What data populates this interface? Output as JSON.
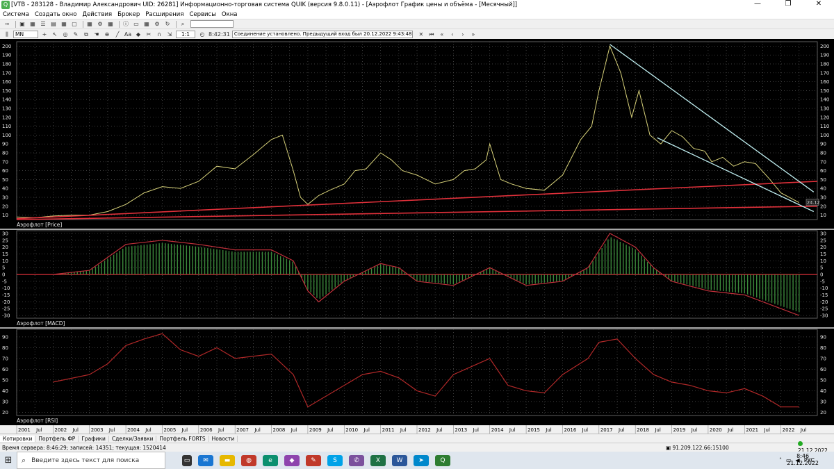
{
  "window": {
    "title": "[VTB - 283128 - Владимир Александрович UID: 26281] Информационно-торговая система QUIK (версия 9.8.0.11) - [Аэрофлот График цены и объёма - [Месячный]]",
    "minimize": "—",
    "restore": "❐",
    "close": "✕"
  },
  "menu": [
    "Система",
    "Создать окно",
    "Действия",
    "Брокер",
    "Расширения",
    "Сервисы",
    "Окна"
  ],
  "toolbar": {
    "interval": "MN",
    "zoom": "1:1",
    "time": "8:42:31",
    "status_message": "Соединение установлено. Предыдущий вход был 20.12.2022 9:43:48 с"
  },
  "chart": {
    "price_label": "Аэрофлот [Price]",
    "macd_label": "Аэрофлот [MACD]",
    "rsi_label": "Аэрофлот [RSI]",
    "last_price": "24.12",
    "colors": {
      "price": "#d8d27a",
      "trend": "#e0303a",
      "channel": "#bfeef0",
      "macd_line": "#c0303a",
      "histogram": "#3c8a3c",
      "rsi": "#b02828",
      "grid": "#555555",
      "axis_text": "#e8e8e8"
    },
    "years": [
      "2001",
      "2002",
      "2003",
      "2004",
      "2005",
      "2006",
      "2007",
      "2008",
      "2009",
      "2010",
      "2011",
      "2012",
      "2013",
      "2014",
      "2015",
      "2016",
      "2017",
      "2018",
      "2019",
      "2020",
      "2021",
      "2022"
    ],
    "month_label": "Jul"
  },
  "chart_data": [
    {
      "type": "line",
      "name": "price",
      "x": [
        "2001",
        "2002",
        "2003",
        "2004",
        "2005",
        "2006",
        "2007",
        "2008",
        "2009",
        "2010",
        "2011",
        "2012",
        "2013",
        "2014",
        "2015",
        "2016",
        "2017",
        "2018",
        "2019",
        "2020",
        "2021",
        "2022"
      ],
      "points": [
        [
          2001.0,
          8
        ],
        [
          2001.5,
          7
        ],
        [
          2002.0,
          9
        ],
        [
          2002.5,
          10
        ],
        [
          2003.0,
          10
        ],
        [
          2003.5,
          14
        ],
        [
          2004.0,
          22
        ],
        [
          2004.5,
          35
        ],
        [
          2005.0,
          42
        ],
        [
          2005.5,
          40
        ],
        [
          2006.0,
          48
        ],
        [
          2006.5,
          65
        ],
        [
          2007.0,
          62
        ],
        [
          2007.5,
          78
        ],
        [
          2008.0,
          95
        ],
        [
          2008.3,
          100
        ],
        [
          2008.6,
          60
        ],
        [
          2008.8,
          30
        ],
        [
          2009.0,
          22
        ],
        [
          2009.3,
          32
        ],
        [
          2009.6,
          38
        ],
        [
          2010.0,
          45
        ],
        [
          2010.3,
          60
        ],
        [
          2010.6,
          62
        ],
        [
          2011.0,
          80
        ],
        [
          2011.3,
          72
        ],
        [
          2011.6,
          60
        ],
        [
          2012.0,
          55
        ],
        [
          2012.5,
          45
        ],
        [
          2013.0,
          50
        ],
        [
          2013.3,
          60
        ],
        [
          2013.6,
          62
        ],
        [
          2013.9,
          72
        ],
        [
          2014.0,
          90
        ],
        [
          2014.3,
          50
        ],
        [
          2014.6,
          45
        ],
        [
          2015.0,
          40
        ],
        [
          2015.5,
          38
        ],
        [
          2016.0,
          55
        ],
        [
          2016.5,
          95
        ],
        [
          2016.8,
          110
        ],
        [
          2017.0,
          150
        ],
        [
          2017.3,
          200
        ],
        [
          2017.6,
          170
        ],
        [
          2017.9,
          120
        ],
        [
          2018.1,
          150
        ],
        [
          2018.4,
          100
        ],
        [
          2018.7,
          90
        ],
        [
          2019.0,
          105
        ],
        [
          2019.3,
          98
        ],
        [
          2019.6,
          85
        ],
        [
          2019.9,
          82
        ],
        [
          2020.1,
          70
        ],
        [
          2020.4,
          75
        ],
        [
          2020.7,
          65
        ],
        [
          2021.0,
          70
        ],
        [
          2021.3,
          68
        ],
        [
          2021.7,
          50
        ],
        [
          2022.0,
          35
        ],
        [
          2022.5,
          24.12
        ]
      ],
      "ylim": [
        5,
        205
      ]
    },
    {
      "type": "bar",
      "name": "MACD",
      "ylim": [
        -30,
        32
      ],
      "points": [
        [
          2002.0,
          0
        ],
        [
          2003.0,
          3
        ],
        [
          2004.0,
          22
        ],
        [
          2005.0,
          25
        ],
        [
          2006.0,
          22
        ],
        [
          2007.0,
          18
        ],
        [
          2008.0,
          18
        ],
        [
          2008.6,
          10
        ],
        [
          2009.0,
          -12
        ],
        [
          2009.3,
          -20
        ],
        [
          2010.0,
          -5
        ],
        [
          2011.0,
          8
        ],
        [
          2011.5,
          5
        ],
        [
          2012.0,
          -5
        ],
        [
          2013.0,
          -8
        ],
        [
          2014.0,
          5
        ],
        [
          2015.0,
          -8
        ],
        [
          2016.0,
          -5
        ],
        [
          2016.7,
          5
        ],
        [
          2017.3,
          30
        ],
        [
          2018.0,
          20
        ],
        [
          2018.5,
          5
        ],
        [
          2019.0,
          -5
        ],
        [
          2020.0,
          -12
        ],
        [
          2021.0,
          -15
        ],
        [
          2022.0,
          -25
        ],
        [
          2022.5,
          -30
        ]
      ]
    },
    {
      "type": "line",
      "name": "RSI",
      "ylim": [
        20,
        95
      ],
      "points": [
        [
          2002.0,
          48
        ],
        [
          2003.0,
          55
        ],
        [
          2003.5,
          65
        ],
        [
          2004.0,
          82
        ],
        [
          2004.5,
          88
        ],
        [
          2005.0,
          93
        ],
        [
          2005.5,
          78
        ],
        [
          2006.0,
          72
        ],
        [
          2006.5,
          80
        ],
        [
          2007.0,
          70
        ],
        [
          2008.0,
          74
        ],
        [
          2008.6,
          55
        ],
        [
          2009.0,
          25
        ],
        [
          2009.5,
          35
        ],
        [
          2010.0,
          45
        ],
        [
          2010.5,
          55
        ],
        [
          2011.0,
          58
        ],
        [
          2011.5,
          52
        ],
        [
          2012.0,
          40
        ],
        [
          2012.5,
          35
        ],
        [
          2013.0,
          55
        ],
        [
          2014.0,
          70
        ],
        [
          2014.5,
          45
        ],
        [
          2015.0,
          40
        ],
        [
          2015.5,
          38
        ],
        [
          2016.0,
          55
        ],
        [
          2016.7,
          70
        ],
        [
          2017.0,
          85
        ],
        [
          2017.5,
          88
        ],
        [
          2018.0,
          70
        ],
        [
          2018.5,
          55
        ],
        [
          2019.0,
          48
        ],
        [
          2019.5,
          45
        ],
        [
          2020.0,
          40
        ],
        [
          2020.5,
          38
        ],
        [
          2021.0,
          42
        ],
        [
          2021.5,
          35
        ],
        [
          2022.0,
          25
        ],
        [
          2022.5,
          25
        ]
      ]
    }
  ]
}
